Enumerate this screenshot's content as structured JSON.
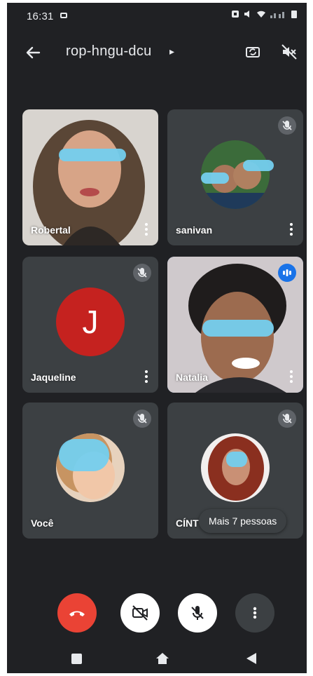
{
  "status_bar": {
    "time": "16:31"
  },
  "top_bar": {
    "meeting_code": "rop-hngu-dcu",
    "caret": "▸"
  },
  "participants": [
    {
      "name": "Robertal",
      "muted": false,
      "speaking": false
    },
    {
      "name": "sanivan",
      "muted": true,
      "speaking": false
    },
    {
      "name": "Jaqueline",
      "muted": true,
      "speaking": false,
      "avatar_letter": "J",
      "avatar_color": "#c5221f"
    },
    {
      "name": "Natalia",
      "muted": false,
      "speaking": true
    },
    {
      "name": "Você",
      "muted": true,
      "speaking": false
    },
    {
      "name": "CÍNT",
      "muted": true,
      "speaking": false
    }
  ],
  "overflow_chip": {
    "label": "Mais 7 pessoas"
  },
  "controls": {
    "end_call": "end-call",
    "camera": "camera-off",
    "microphone": "mic-off",
    "more": "more-options"
  },
  "colors": {
    "background": "#202124",
    "tile": "#3c4043",
    "end_call": "#ea4335",
    "active_speaker": "#8ab4f8",
    "speaking_badge": "#1a73e8"
  }
}
